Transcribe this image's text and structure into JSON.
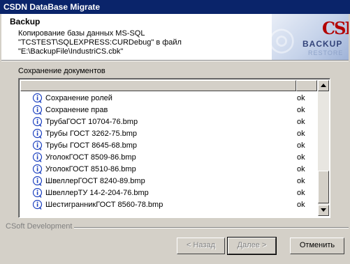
{
  "window": {
    "title": "CSDN DataBase Migrate"
  },
  "header": {
    "title": "Backup",
    "description": "Копирование базы данных MS-SQL\n\"TCSTEST\\SQLEXPRESS:CURDebug\" в файл\n\"E:\\BackupFile\\IndustriCS.cbk\"",
    "logo": {
      "main": "CSDN",
      "line1": "BACKUP",
      "line2": "RESTORE"
    }
  },
  "group": {
    "label": "Сохранение документов"
  },
  "list": {
    "columns": [
      "",
      ""
    ],
    "rows": [
      {
        "name": "Сохранение ролей",
        "status": "ok",
        "icon": "info-icon"
      },
      {
        "name": "Сохранение прав",
        "status": "ok",
        "icon": "info-icon"
      },
      {
        "name": "ТрубаГОСТ 10704-76.bmp",
        "status": "ok",
        "icon": "info-icon"
      },
      {
        "name": "Трубы ГОСТ 3262-75.bmp",
        "status": "ok",
        "icon": "info-icon"
      },
      {
        "name": "Трубы ГОСТ 8645-68.bmp",
        "status": "ok",
        "icon": "info-icon"
      },
      {
        "name": "УголокГОСТ 8509-86.bmp",
        "status": "ok",
        "icon": "info-icon"
      },
      {
        "name": "УголокГОСТ 8510-86.bmp",
        "status": "ok",
        "icon": "info-icon"
      },
      {
        "name": "ШвеллерГОСТ 8240-89.bmp",
        "status": "ok",
        "icon": "info-icon"
      },
      {
        "name": "ШвеллерТУ 14-2-204-76.bmp",
        "status": "ok",
        "icon": "info-icon"
      },
      {
        "name": "ШестигранникГОСТ 8560-78.bmp",
        "status": "ok",
        "icon": "info-icon"
      }
    ]
  },
  "footer": {
    "brand": "CSoft Development",
    "back_label": "< Назад",
    "next_label": "Далее >",
    "cancel_label": "Отменить"
  },
  "colors": {
    "titlebar": "#0a246a",
    "dialog": "#d4d0c8",
    "info_icon": "#1a3fbf"
  }
}
